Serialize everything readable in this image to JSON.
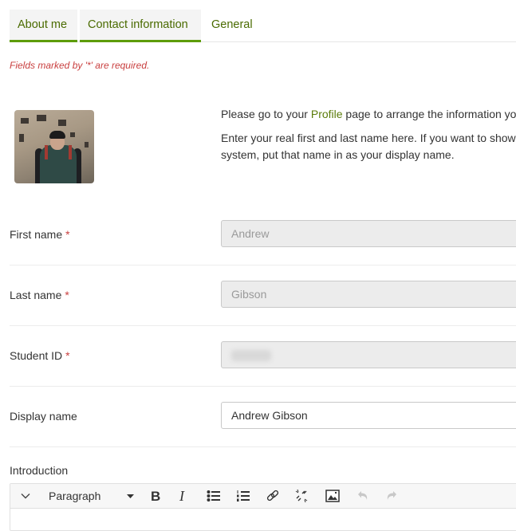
{
  "tabs": [
    {
      "label": "About me",
      "active": true
    },
    {
      "label": "Contact information",
      "active": true
    },
    {
      "label": "General",
      "active": false
    }
  ],
  "required_note": "Fields marked by '*' are required.",
  "intro": {
    "line1_before": "Please go to your ",
    "line1_link": "Profile",
    "line1_after": " page to arrange the information yo",
    "line2": "Enter your real first and last name here. If you want to show",
    "line3": "system, put that name in as your display name."
  },
  "fields": [
    {
      "label": "First name",
      "required": "*",
      "value": "Andrew",
      "readonly": true
    },
    {
      "label": "Last name",
      "required": "*",
      "value": "Gibson",
      "readonly": true
    },
    {
      "label": "Student ID",
      "required": "*",
      "value": "",
      "readonly": true,
      "blurred": true
    },
    {
      "label": "Display name",
      "required": "",
      "value": "Andrew Gibson",
      "readonly": false
    }
  ],
  "introduction": {
    "label": "Introduction",
    "toolbar": {
      "block_format": "Paragraph",
      "buttons": [
        "toggle-toolbar",
        "bold",
        "italic",
        "bullet-list",
        "numbered-list",
        "link",
        "unlink",
        "image",
        "undo",
        "redo"
      ]
    }
  },
  "colors": {
    "accent": "#5d9c0a",
    "link": "#5b7c0a",
    "required": "#c94040"
  }
}
